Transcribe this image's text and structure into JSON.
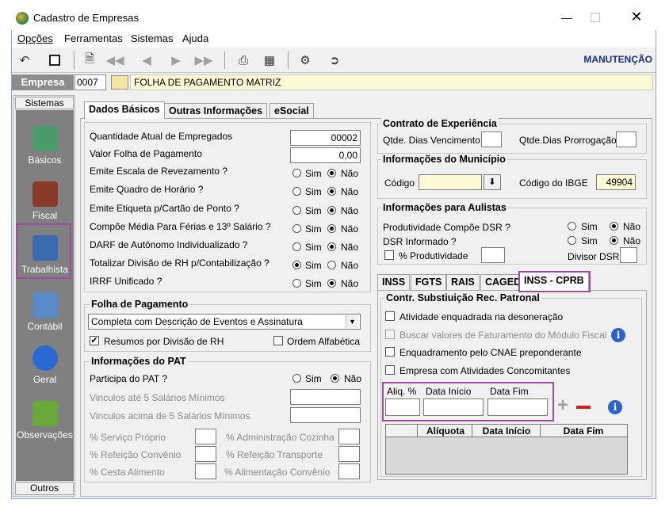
{
  "window": {
    "title": "Cadastro de Empresas",
    "title_icon": "app-globe-icon"
  },
  "menu": [
    "Opções",
    "Ferramentas",
    "Sistemas",
    "Ajuda"
  ],
  "toolbar": {
    "mode": "MANUTENÇÃO"
  },
  "empresa": {
    "label": "Empresa",
    "code": "0007",
    "name": "FOLHA DE PAGAMENTO MATRIZ"
  },
  "sidebar": {
    "header": "Sistemas",
    "footer": "Outros",
    "items": [
      "Básicos",
      "Fiscal",
      "Trabalhista",
      "Contábil",
      "Geral",
      "Observações"
    ]
  },
  "tabs": [
    "Dados Básicos",
    "Outras Informações",
    "eSocial"
  ],
  "dados": {
    "qtd_label": "Quantidade Atual de Empregados",
    "qtd_value": "00002",
    "valor_label": "Valor Folha de Pagamento",
    "valor_value": "0,00",
    "rows": [
      {
        "label": "Emite Escala de Revezamento ?",
        "sel": "Não"
      },
      {
        "label": "Emite Quadro de Horário ?",
        "sel": "Não"
      },
      {
        "label": "Emite Etiqueta p/Cartão de Ponto ?",
        "sel": "Não"
      },
      {
        "label": "Compõe Média Para Férias e 13º Salário ?",
        "sel": "Não"
      },
      {
        "label": "DARF de Autônomo Individualizado ?",
        "sel": "Não"
      },
      {
        "label": "Totalizar Divisão de RH p/Contabilização ?",
        "sel": "Sim"
      },
      {
        "label": "IRRF Unificado ?",
        "sel": "Não"
      }
    ],
    "sim": "Sim",
    "nao": "Não"
  },
  "folha": {
    "title": "Folha de Pagamento",
    "select": "Completa com Descrição de Eventos e Assinatura",
    "resumos": "Resumos por Divisão de RH",
    "ordem": "Ordem Alfabética"
  },
  "pat": {
    "title": "Informações do PAT",
    "participa": "Participa do PAT ?",
    "vinc5": "Vinculos até 5 Salários Mínimos",
    "vinc5p": "Vinculos acima de 5 Salários Mínimos",
    "servico": "% Serviço Próprio",
    "admin": "% Administração Cozinha",
    "refconv": "% Refeição Convênio",
    "reftrans": "% Refeição Transporte",
    "cesta": "% Cesta Alimento",
    "alimconv": "% Alimentação Convênio"
  },
  "contrato": {
    "title": "Contrato de Experiência",
    "venc": "Qtde. Dias Vencimento",
    "prorr": "Qtde.Dias Prorrogação"
  },
  "municipio": {
    "title": "Informações do Município",
    "codigo": "Código",
    "ibge_label": "Código do IBGE",
    "ibge_value": "49904"
  },
  "aulistas": {
    "title": "Informações para Aulistas",
    "dsr": "Produtividade Compõe DSR ?",
    "dsr_inf": "DSR Informado ?",
    "perc": "% Produtividade",
    "divisor": "Divisor DSR"
  },
  "subtabs": [
    "INSS",
    "FGTS",
    "RAIS",
    "CAGED",
    "INSS - CPRB"
  ],
  "cprb": {
    "title": "Contr. Substiuição Rec. Patronal",
    "c1": "Atividade enquadrada na desoneração",
    "c2": "Buscar valores de Faturamento do Módulo Fiscal",
    "c3": "Enquadramento pelo CNAE preponderante",
    "c4": "Empresa com Atividades Concomitantes",
    "aliq": "Aliq. %",
    "dini": "Data Início",
    "dfim": "Data Fim",
    "grid_cols": [
      "Alíquota",
      "Data Início",
      "Data Fim"
    ]
  }
}
